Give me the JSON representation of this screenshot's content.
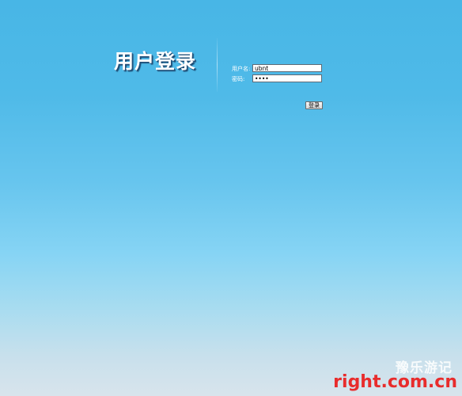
{
  "login_panel": {
    "title": "用户登录",
    "username_label": "用户名:",
    "username_value": "ubnt",
    "password_label": "密码:",
    "password_value": "ubnt",
    "submit_label": "登录"
  },
  "watermark": {
    "site_name": "豫乐游记",
    "domain": "right.com.cn"
  },
  "colors": {
    "background_top": "#48b6e6",
    "background_bottom": "#d8e4ec",
    "watermark_red": "#e82c2c"
  }
}
